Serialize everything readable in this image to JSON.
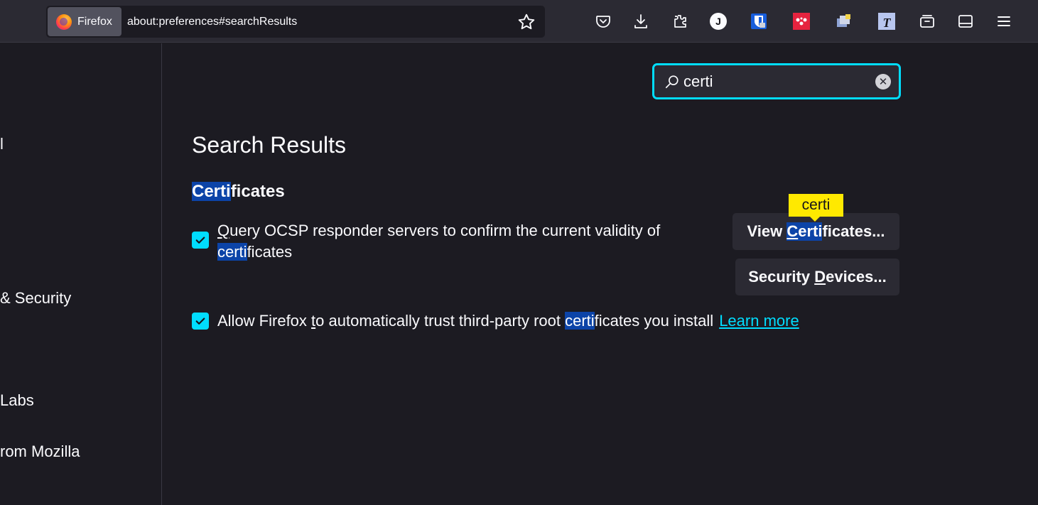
{
  "browser": {
    "identity_label": "Firefox",
    "url": "about:preferences#searchResults",
    "toolbar_icons": [
      "bookmark-star-icon",
      "pocket-icon",
      "downloads-icon",
      "extensions-icon",
      "account-j-icon",
      "bitwarden-icon",
      "mendeley-icon",
      "clipboard-extension-icon",
      "translate-extension-icon",
      "firefox-view-icon",
      "sidebar-icon",
      "menu-icon"
    ],
    "account_initial": "J"
  },
  "sidebar": {
    "items": [
      {
        "label": "l"
      },
      {
        "label": " & Security"
      },
      {
        "label": " Labs"
      },
      {
        "label": "rom Mozilla"
      }
    ]
  },
  "search": {
    "value": "certi"
  },
  "main": {
    "heading": "Search Results",
    "group": {
      "title_highlight": "Certi",
      "title_rest": "ficates"
    },
    "ocsp": {
      "mnemonic": "Q",
      "text_before": "uery OCSP responder servers to confirm the current validity of ",
      "highlight": "certi",
      "text_after": "ficates",
      "checked": true
    },
    "trust": {
      "text_start": "Allow Firefox ",
      "mnemonic": "t",
      "text_mid": "o automatically trust third-party root ",
      "highlight": "certi",
      "text_after": "ficates you install",
      "link": "Learn more",
      "checked": true
    },
    "view_certificates": {
      "prefix": "View ",
      "highlight_mnemonic": "C",
      "highlight_rest": "erti",
      "suffix": "ficates..."
    },
    "security_devices": {
      "prefix": "Security ",
      "mnemonic": "D",
      "suffix": "evices..."
    },
    "tooltip": "certi"
  },
  "colors": {
    "accent": "#00ddff",
    "highlight": "#0c44a8",
    "tooltip": "#ffe900",
    "background": "#1c1b22"
  }
}
